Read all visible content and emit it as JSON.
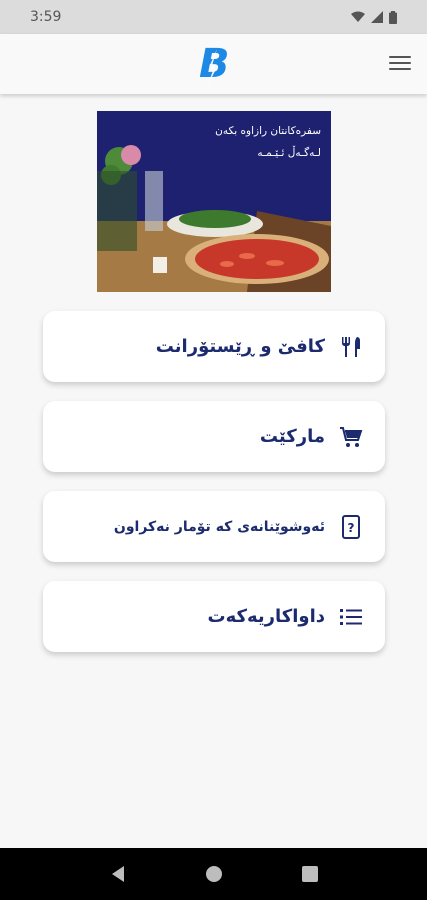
{
  "status_bar": {
    "time": "3:59",
    "icons": [
      "wifi-icon",
      "signal-icon",
      "battery-icon"
    ]
  },
  "app_bar": {
    "logo_letter": "B",
    "menu_icon": "hamburger-menu-icon"
  },
  "banner": {
    "line1": "سفرەکانتان رازاوە بکەن",
    "line2": "لـەگـەڵ ئـێـمـە"
  },
  "cards": [
    {
      "label": "کافێ و ڕێستۆرانت",
      "icon": "fork-knife-icon"
    },
    {
      "label": "مارکێت",
      "icon": "cart-icon"
    },
    {
      "label": "ئەوشوێنانەی کە تۆمار نەکراون",
      "icon": "phone-question-icon"
    },
    {
      "label": "داواکاریەکەت",
      "icon": "list-icon"
    }
  ],
  "colors": {
    "primary": "#1c2a6e",
    "logo": "#1e88e5",
    "banner_bg": "#1d2170"
  }
}
